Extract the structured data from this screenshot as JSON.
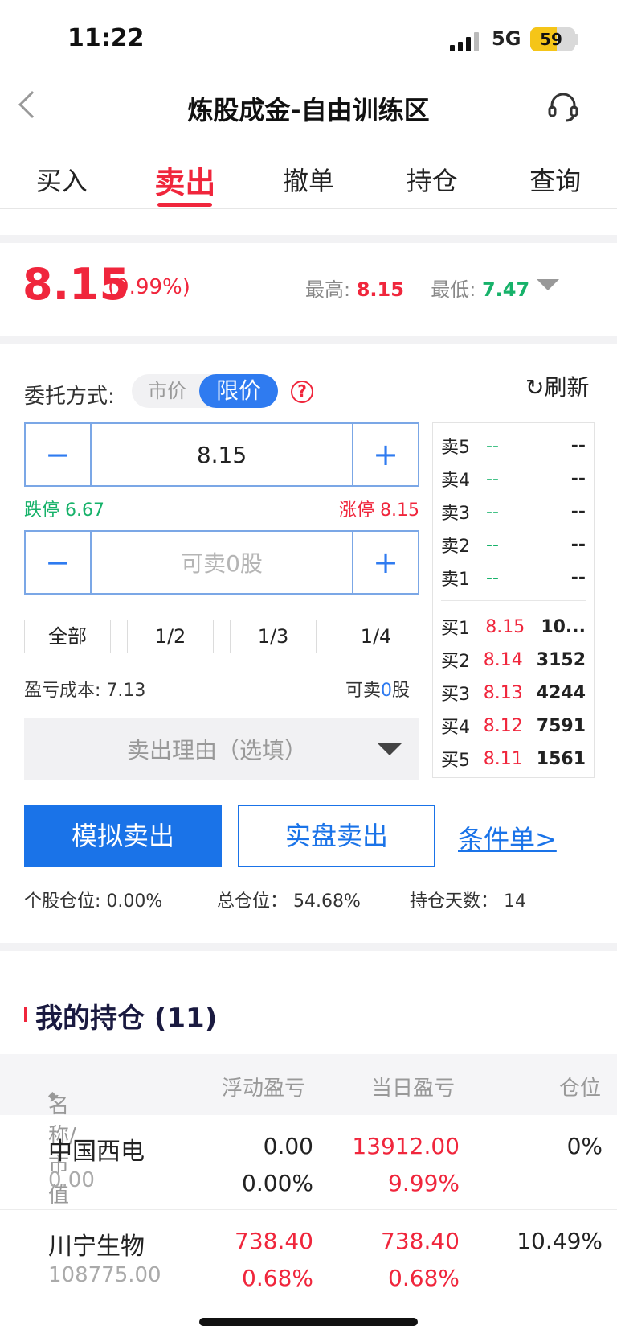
{
  "status": {
    "time": "11:22",
    "network": "5G",
    "battery": "59"
  },
  "header": {
    "title": "炼股成金-自由训练区"
  },
  "tabs": [
    "买入",
    "卖出",
    "撤单",
    "持仓",
    "查询"
  ],
  "quote": {
    "price": "8.15",
    "change_pct": "(9.99%)",
    "high_label": "最高:",
    "high": "8.15",
    "low_label": "最低:",
    "low": "7.47"
  },
  "order": {
    "mode_label": "委托方式:",
    "mode_options": [
      "市价",
      "限价"
    ],
    "refresh": "刷新",
    "price_value": "8.15",
    "limit_down": "跌停 6.67",
    "limit_up": "涨停 8.15",
    "qty_placeholder": "可卖0股",
    "fractions": [
      "全部",
      "1/2",
      "1/3",
      "1/4"
    ],
    "cost_label": "盈亏成本: 7.13",
    "avail_prefix": "可卖",
    "avail_num": "0",
    "avail_suffix": "股",
    "reason_placeholder": "卖出理由（选填）"
  },
  "book": {
    "asks": [
      {
        "k": "卖5",
        "p": "--",
        "v": "--"
      },
      {
        "k": "卖4",
        "p": "--",
        "v": "--"
      },
      {
        "k": "卖3",
        "p": "--",
        "v": "--"
      },
      {
        "k": "卖2",
        "p": "--",
        "v": "--"
      },
      {
        "k": "卖1",
        "p": "--",
        "v": "--"
      }
    ],
    "bids": [
      {
        "k": "买1",
        "p": "8.15",
        "v": "10..."
      },
      {
        "k": "买2",
        "p": "8.14",
        "v": "3152"
      },
      {
        "k": "买3",
        "p": "8.13",
        "v": "4244"
      },
      {
        "k": "买4",
        "p": "8.12",
        "v": "7591"
      },
      {
        "k": "买5",
        "p": "8.11",
        "v": "1561"
      }
    ]
  },
  "actions": {
    "simulate": "模拟卖出",
    "real": "实盘卖出",
    "conditional": "条件单>"
  },
  "stats": {
    "stock_position": "个股仓位: 0.00%",
    "total_position": "总仓位： 54.68%",
    "days": "持仓天数： 14"
  },
  "holdings": {
    "title": "我的持仓 (11)",
    "columns": [
      "名称/市值",
      "浮动盈亏",
      "当日盈亏",
      "仓位"
    ],
    "rows": [
      {
        "name": "中国西电",
        "value": "0.00",
        "float_pl": "0.00",
        "float_pct": "0.00%",
        "day_pl": "13912.00",
        "day_pct": "9.99%",
        "position": "0%"
      },
      {
        "name": "川宁生物",
        "value": "108775.00",
        "float_pl": "738.40",
        "float_pct": "0.68%",
        "day_pl": "738.40",
        "day_pct": "0.68%",
        "position": "10.49%"
      }
    ]
  },
  "colors": {
    "up": "#f0263c",
    "down": "#17b26a",
    "accent": "#1a73e8"
  }
}
